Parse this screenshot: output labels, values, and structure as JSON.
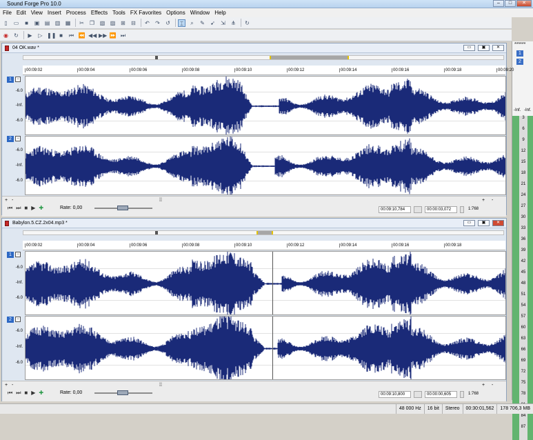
{
  "app": {
    "title": "Sound Forge Pro 10.0"
  },
  "menu": [
    "File",
    "Edit",
    "View",
    "Insert",
    "Process",
    "Effects",
    "Tools",
    "FX Favorites",
    "Options",
    "Window",
    "Help"
  ],
  "meter": {
    "top_label": "******",
    "ch1": "1",
    "ch2": "2",
    "inf_left": "-Inf.",
    "inf_right": "-Inf.",
    "scale": [
      "3",
      "6",
      "9",
      "12",
      "15",
      "18",
      "21",
      "24",
      "27",
      "30",
      "33",
      "36",
      "39",
      "42",
      "45",
      "48",
      "51",
      "54",
      "57",
      "60",
      "63",
      "66",
      "69",
      "72",
      "75",
      "78",
      "81",
      "84",
      "87"
    ]
  },
  "docs": [
    {
      "name": "04 OK.wav *",
      "ruler": [
        "00:09:02",
        "00:09:04",
        "00:09:06",
        "00:09:08",
        "00:09:10",
        "00:09:12",
        "00:09:14",
        "00:09:16",
        "00:09:18",
        "00:09:20"
      ],
      "channels": [
        {
          "num": "1",
          "labels": [
            "-6.0",
            "-Inf.",
            "-6.0"
          ]
        },
        {
          "num": "2",
          "labels": [
            "-6.0",
            "-Inf.",
            "-6.0"
          ]
        }
      ],
      "rate": "Rate: 0,00",
      "pos": "00:09:10,784",
      "len": "00:00:03,072",
      "zoom": "1:768",
      "plus": "+",
      "minus": "-"
    },
    {
      "name": "Babylon.5.CZ.2x04.mp3 *",
      "ruler": [
        "00:09:02",
        "00:09:04",
        "00:09:06",
        "00:09:08",
        "00:09:10",
        "00:09:12",
        "00:09:14",
        "00:09:16",
        "00:09:18"
      ],
      "channels": [
        {
          "num": "1",
          "labels": [
            "-6.0",
            "-Inf.",
            "-6.0"
          ]
        },
        {
          "num": "2",
          "labels": [
            "-6.0",
            "-Inf.",
            "-6.0"
          ]
        }
      ],
      "rate": "Rate: 0,00",
      "pos": "00:09:10,800",
      "len": "00:00:00,605",
      "zoom": "1:768",
      "plus": "+",
      "minus": "-"
    }
  ],
  "status": [
    "48 000 Hz",
    "16 bit",
    "Stereo",
    "00:30:01,562",
    "178 706,3 MB"
  ],
  "colors": {
    "waveform": "#1a2a78",
    "background": "#ffffff"
  }
}
